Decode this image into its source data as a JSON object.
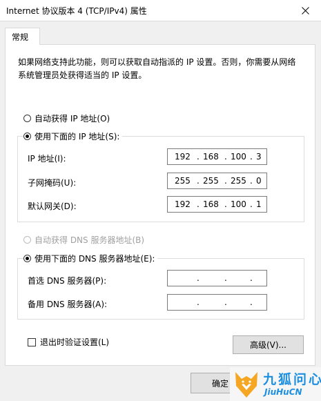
{
  "window": {
    "title": "Internet 协议版本 4 (TCP/IPv4) 属性"
  },
  "tabs": [
    {
      "label": "常规"
    }
  ],
  "description": "如果网络支持此功能，则可以获取自动指派的 IP 设置。否则，你需要从网络系统管理员处获得适当的 IP 设置。",
  "ip_section": {
    "auto_label": "自动获得 IP 地址(O)",
    "manual_label": "使用下面的 IP 地址(S):",
    "selected": "manual",
    "fields": [
      {
        "label": "IP 地址(I):",
        "octets": [
          "192",
          "168",
          "100",
          "3"
        ]
      },
      {
        "label": "子网掩码(U):",
        "octets": [
          "255",
          "255",
          "255",
          "0"
        ]
      },
      {
        "label": "默认网关(D):",
        "octets": [
          "192",
          "168",
          "100",
          "1"
        ]
      }
    ]
  },
  "dns_section": {
    "auto_label": "自动获得 DNS 服务器地址(B)",
    "auto_disabled": true,
    "manual_label": "使用下面的 DNS 服务器地址(E):",
    "selected": "manual",
    "fields": [
      {
        "label": "首选 DNS 服务器(P):",
        "octets": [
          "",
          "",
          "",
          ""
        ]
      },
      {
        "label": "备用 DNS 服务器(A):",
        "octets": [
          "",
          "",
          "",
          ""
        ]
      }
    ]
  },
  "validate_on_exit": {
    "label": "退出时验证设置(L)",
    "checked": false
  },
  "buttons": {
    "advanced": "高级(V)...",
    "ok": "确定"
  },
  "watermark": {
    "cn": "九狐问心",
    "en": "JiuHuCN"
  },
  "colors": {
    "watermark_blue": "#1d8fe1",
    "watermark_orange": "#f5a623"
  }
}
